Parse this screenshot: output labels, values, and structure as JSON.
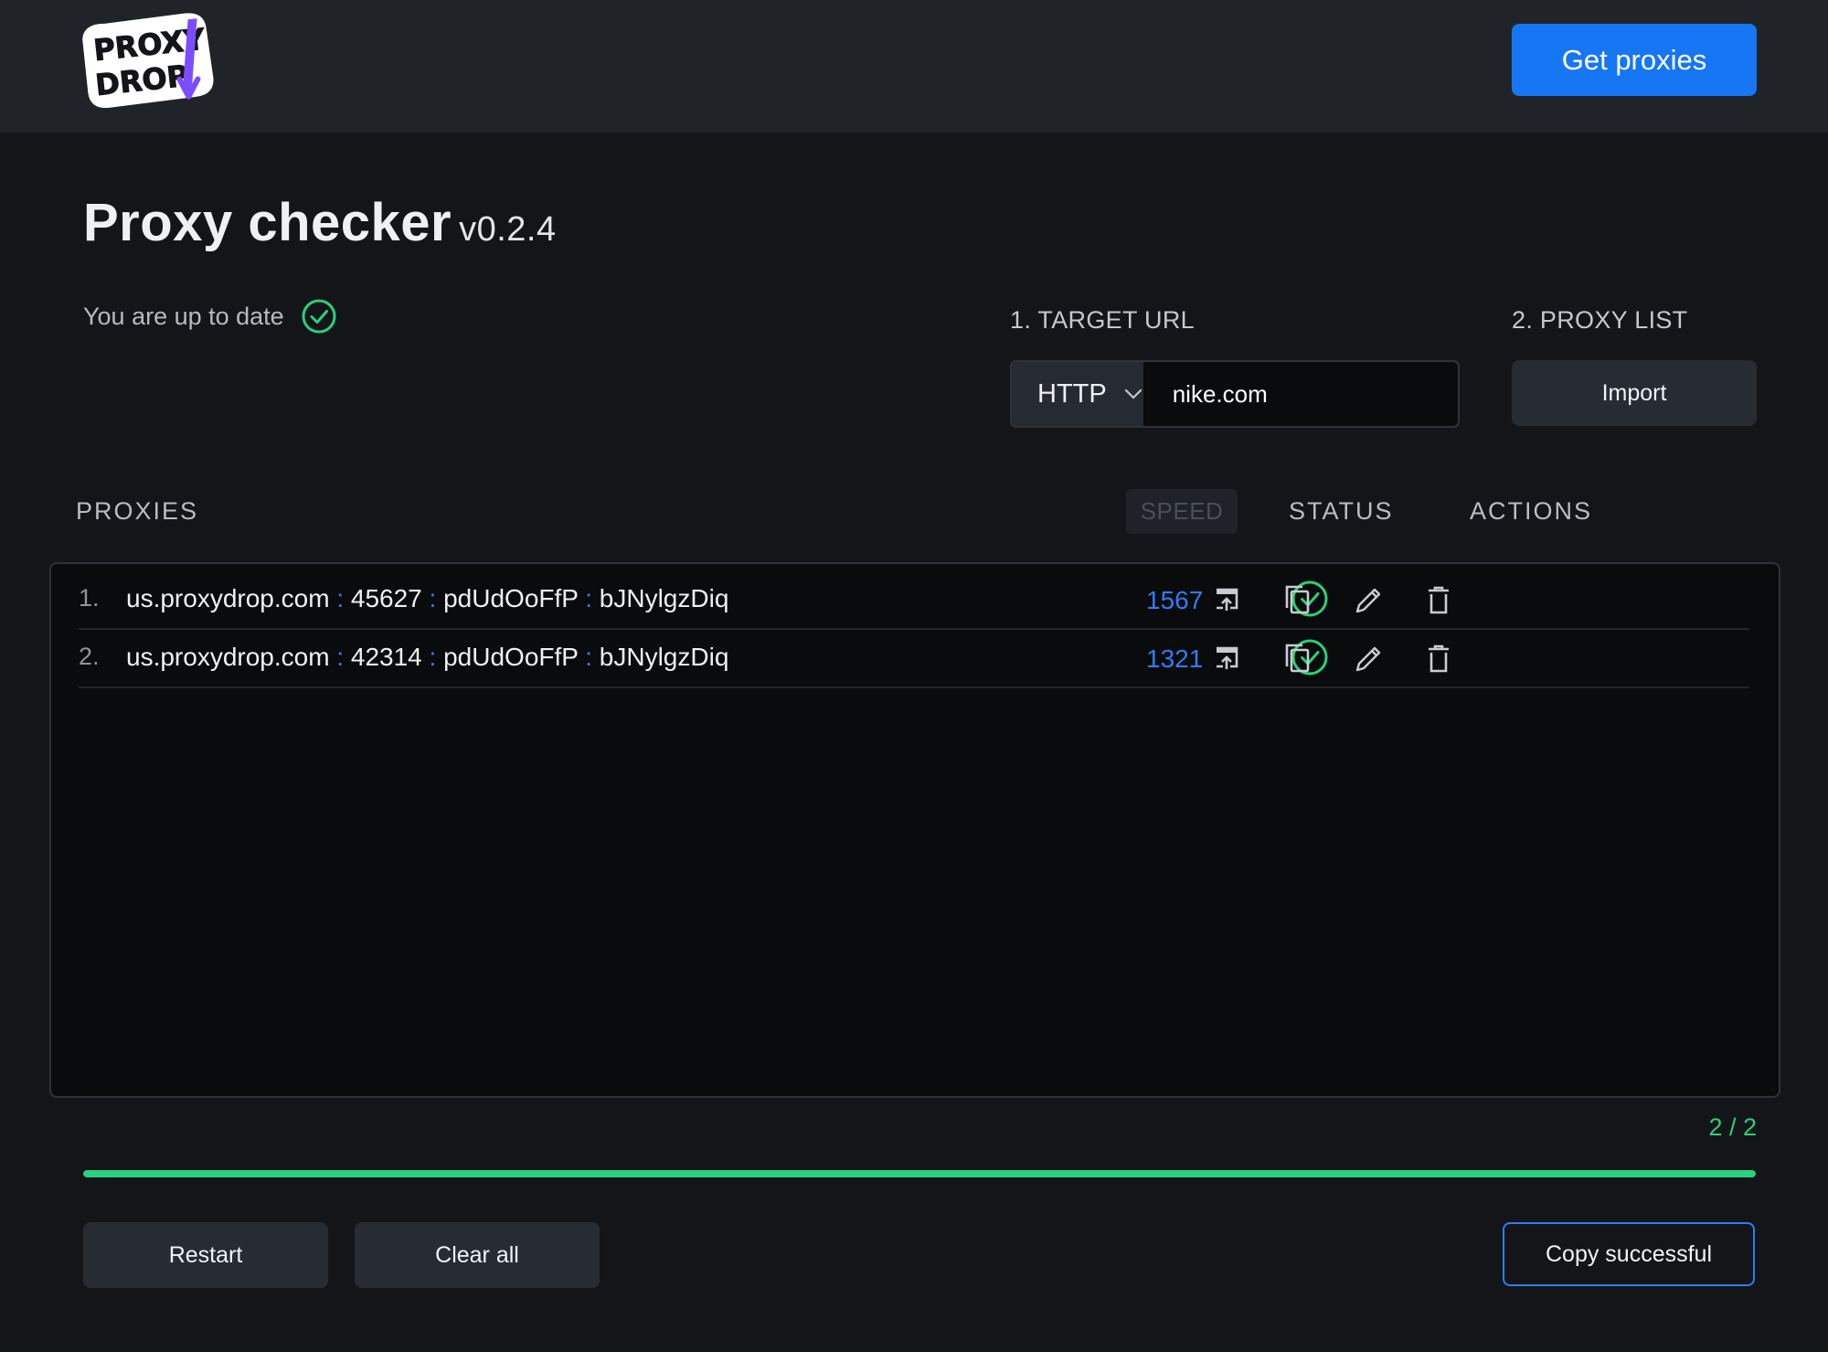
{
  "header": {
    "logo_text_line1": "PROXY",
    "logo_text_line2": "DROP",
    "get_proxies_label": "Get proxies"
  },
  "page": {
    "title": "Proxy checker",
    "version": "v0.2.4",
    "update_status": "You are up to date"
  },
  "target": {
    "label": "1. TARGET URL",
    "protocol": "HTTP",
    "url_value": "nike.com"
  },
  "proxy_list": {
    "label": "2. PROXY LIST",
    "import_label": "Import"
  },
  "columns": {
    "proxies": "PROXIES",
    "speed": "SPEED",
    "status": "STATUS",
    "actions": "ACTIONS"
  },
  "rows": [
    {
      "index": "1.",
      "host": "us.proxydrop.com",
      "port": "45627",
      "user": "pdUdOoFfP",
      "pass": "bJNylgzDiq",
      "speed": "1567",
      "status": "success"
    },
    {
      "index": "2.",
      "host": "us.proxydrop.com",
      "port": "42314",
      "user": "pdUdOoFfP",
      "pass": "bJNylgzDiq",
      "speed": "1321",
      "status": "success"
    }
  ],
  "row_actions": [
    "open-icon",
    "copy-icon",
    "edit-icon",
    "delete-icon"
  ],
  "progress": {
    "counter": "2 / 2",
    "percent": 100
  },
  "footer": {
    "restart_label": "Restart",
    "clear_label": "Clear all",
    "copy_label": "Copy successful"
  },
  "colors": {
    "accent_blue": "#1676f3",
    "success_green": "#28d17c",
    "background": "#131518",
    "topbar": "#202429"
  }
}
